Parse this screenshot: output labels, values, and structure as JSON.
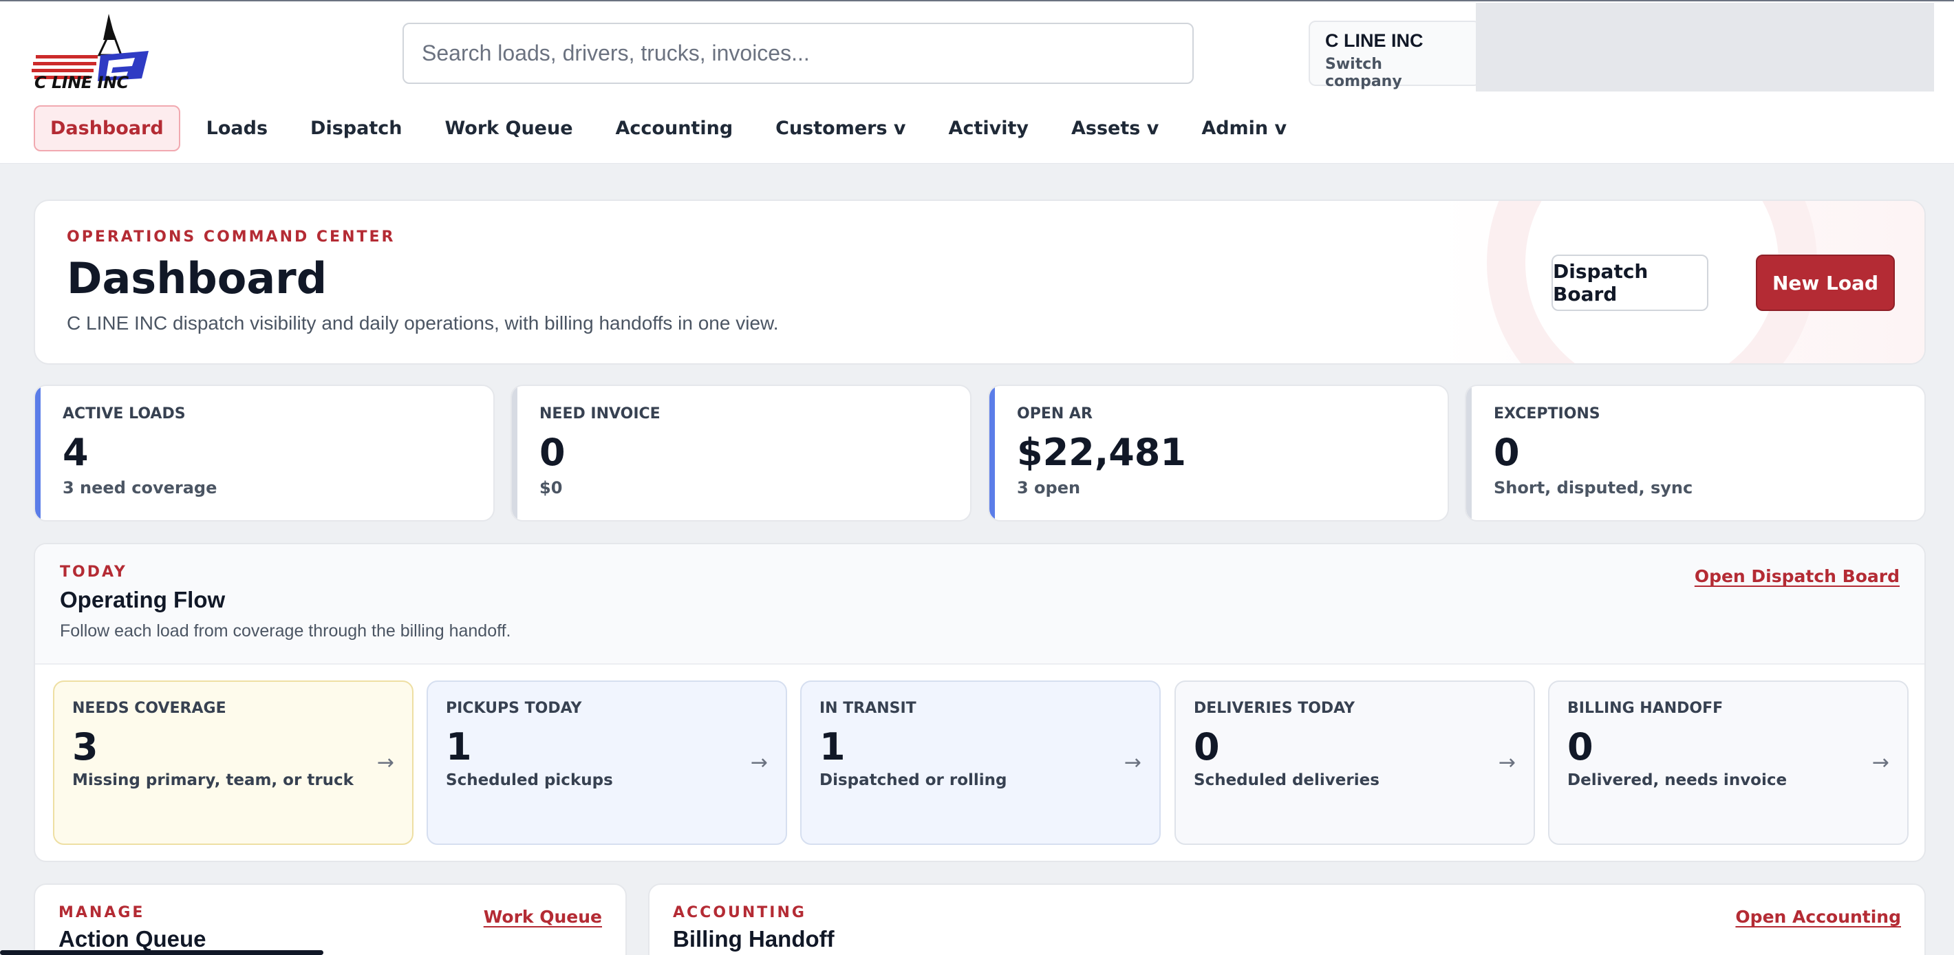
{
  "brand": {
    "logo_text": "C LINE INC"
  },
  "search": {
    "placeholder": "Search loads, drivers, trucks, invoices..."
  },
  "company": {
    "name": "C LINE INC",
    "switch_label": "Switch company"
  },
  "nav": [
    {
      "label": "Dashboard",
      "active": true
    },
    {
      "label": "Loads"
    },
    {
      "label": "Dispatch"
    },
    {
      "label": "Work Queue"
    },
    {
      "label": "Accounting"
    },
    {
      "label": "Customers v"
    },
    {
      "label": "Activity"
    },
    {
      "label": "Assets v"
    },
    {
      "label": "Admin v"
    }
  ],
  "hero": {
    "eyebrow": "OPERATIONS COMMAND CENTER",
    "title": "Dashboard",
    "subtitle": "C LINE INC dispatch visibility and daily operations, with billing handoffs in one view.",
    "secondary_button": "Dispatch Board",
    "primary_button": "New Load"
  },
  "kpis": [
    {
      "label": "ACTIVE LOADS",
      "value": "4",
      "sub": "3 need coverage",
      "accent": "#5b7de8"
    },
    {
      "label": "NEED INVOICE",
      "value": "0",
      "sub": "$0",
      "accent": "#d7dbe3"
    },
    {
      "label": "OPEN AR",
      "value": "$22,481",
      "sub": "3 open",
      "accent": "#5b7de8"
    },
    {
      "label": "EXCEPTIONS",
      "value": "0",
      "sub": "Short, disputed, sync",
      "accent": "#d7dbe3"
    }
  ],
  "flow": {
    "eyebrow": "TODAY",
    "title": "Operating Flow",
    "subtitle": "Follow each load from coverage through the billing handoff.",
    "link": "Open Dispatch Board",
    "arrow": "→",
    "cards": [
      {
        "label": "NEEDS COVERAGE",
        "value": "3",
        "sub": "Missing primary, team, or truck"
      },
      {
        "label": "PICKUPS TODAY",
        "value": "1",
        "sub": "Scheduled pickups"
      },
      {
        "label": "IN TRANSIT",
        "value": "1",
        "sub": "Dispatched or rolling"
      },
      {
        "label": "DELIVERIES TODAY",
        "value": "0",
        "sub": "Scheduled deliveries"
      },
      {
        "label": "BILLING HANDOFF",
        "value": "0",
        "sub": "Delivered, needs invoice"
      }
    ]
  },
  "manage": {
    "eyebrow": "MANAGE",
    "title": "Action Queue",
    "link": "Work Queue"
  },
  "accounting": {
    "eyebrow": "ACCOUNTING",
    "title": "Billing Handoff",
    "link": "Open Accounting"
  }
}
